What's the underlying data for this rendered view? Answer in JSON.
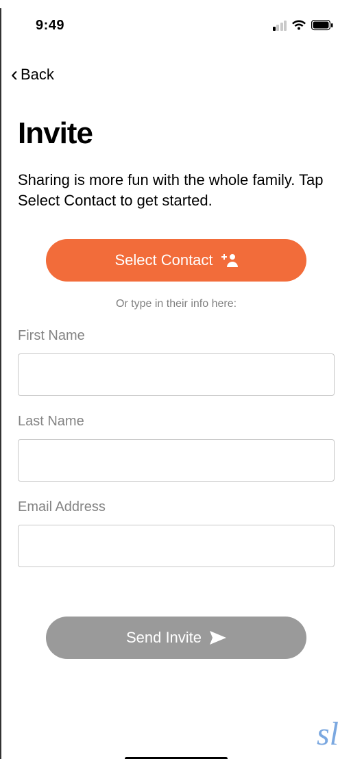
{
  "status": {
    "time": "9:49"
  },
  "nav": {
    "back_label": "Back"
  },
  "page": {
    "title": "Invite",
    "subtitle": "Sharing is more fun with the whole family. Tap Select Contact to get started."
  },
  "actions": {
    "select_contact_label": "Select Contact",
    "send_invite_label": "Send Invite"
  },
  "divider": {
    "text": "Or type in their info here:"
  },
  "form": {
    "first_name": {
      "label": "First Name",
      "value": ""
    },
    "last_name": {
      "label": "Last Name",
      "value": ""
    },
    "email": {
      "label": "Email Address",
      "value": ""
    }
  },
  "brand": {
    "logo_text": "sl"
  },
  "colors": {
    "accent": "#f26c3a",
    "disabled": "#9a9a9a",
    "logo": "#7ba8e0"
  }
}
